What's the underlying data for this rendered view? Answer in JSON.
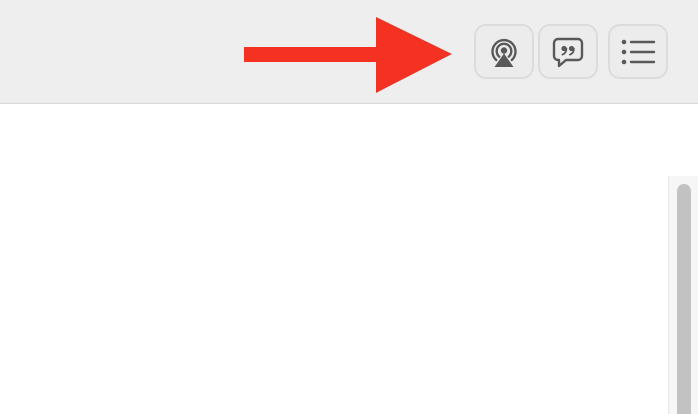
{
  "toolbar": {
    "buttons": [
      {
        "id": "airplay",
        "icon": "airplay-audio-icon"
      },
      {
        "id": "lyrics",
        "icon": "speech-bubble-quote-icon"
      },
      {
        "id": "queue",
        "icon": "list-bullets-icon"
      }
    ],
    "colors": {
      "background": "#eeeeee",
      "button_border": "#dcdcdc",
      "icon": "#595959"
    }
  },
  "annotation": {
    "icon": "right-arrow-icon",
    "color": "#f53222"
  },
  "content": {
    "background": "#ffffff"
  },
  "scrollbar": {
    "thumb_color": "#c2c2c2"
  }
}
